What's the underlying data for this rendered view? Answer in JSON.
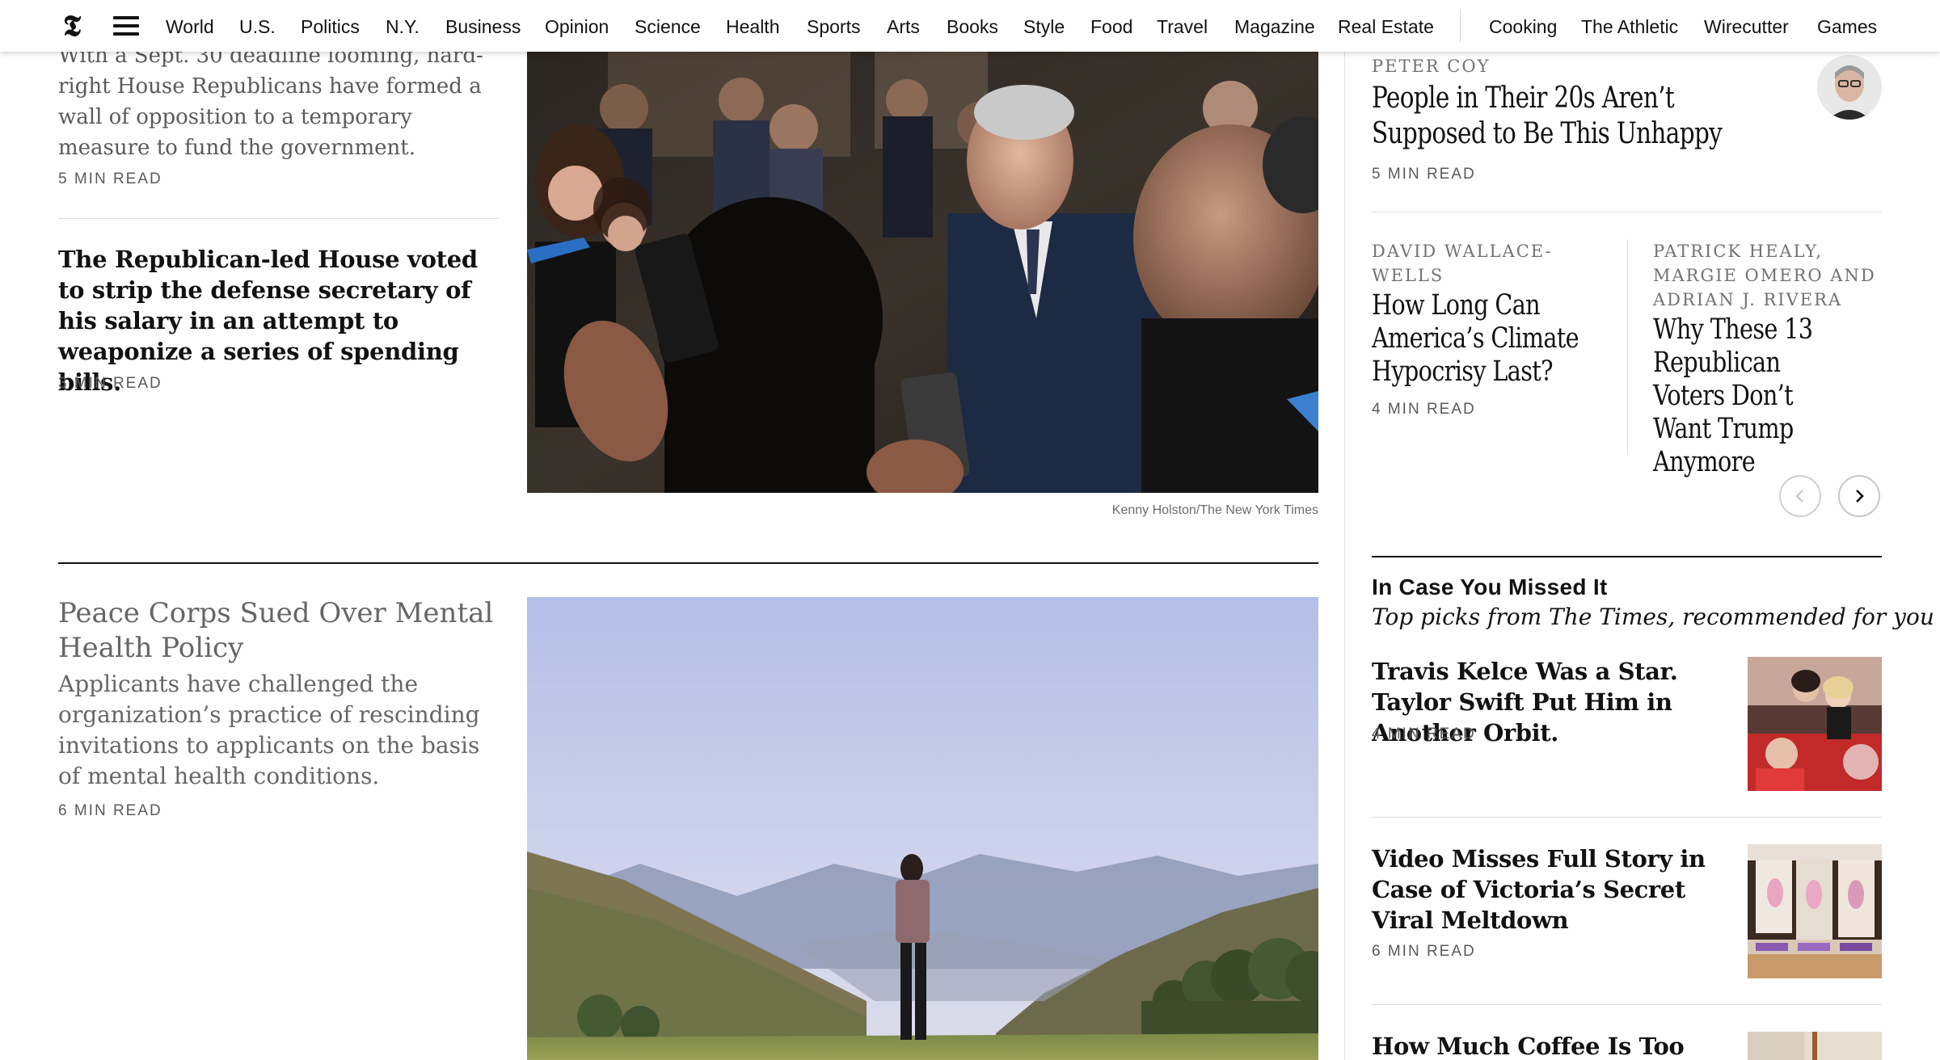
{
  "nav": {
    "logo": "𝕿",
    "items": [
      "World",
      "U.S.",
      "Politics",
      "N.Y.",
      "Business",
      "Opinion",
      "Science",
      "Health",
      "Sports",
      "Arts",
      "Books",
      "Style",
      "Food",
      "Travel",
      "Magazine",
      "Real Estate"
    ],
    "products": [
      "Cooking",
      "The Athletic",
      "Wirecutter",
      "Games"
    ]
  },
  "left": {
    "story1": {
      "summary": "With a Sept. 30 deadline looming, hard-right House Republicans have formed a wall of opposition to a temporary measure to fund the government.",
      "read_time": "5 MIN READ"
    },
    "story2": {
      "headline": "The Republican-led House voted to strip the defense secretary of his salary in an attempt to weaponize a series of spending bills.",
      "read_time": "3 MIN READ"
    },
    "story3": {
      "headline": "Peace Corps Sued Over Mental Health Policy",
      "summary": "Applicants have challenged the organization’s practice of rescinding invitations to applicants on the basis of mental health conditions.",
      "read_time": "6 MIN READ"
    },
    "photo_credit": "Kenny Holston/The New York Times"
  },
  "opinion": {
    "featured": {
      "byline": "PETER COY",
      "headline": "People in Their 20s Aren’t Supposed to Be This Unhappy",
      "read_time": "5 MIN READ"
    },
    "card1": {
      "byline": "DAVID WALLACE-WELLS",
      "headline": "How Long Can America’s Climate Hypocrisy Last?",
      "read_time": "4 MIN READ"
    },
    "card2": {
      "byline": "PATRICK HEALY, MARGIE OMERO AND ADRIAN J. RIVERA",
      "headline": "Why These 13 Republican Voters Don’t Want Trump Anymore"
    }
  },
  "icymi": {
    "title": "In Case You Missed It",
    "subtitle": "Top picks from The Times, recommended for you",
    "items": [
      {
        "headline": "Travis Kelce Was a Star. Taylor Swift Put Him in Another Orbit.",
        "read_time": "4 MIN READ"
      },
      {
        "headline": "Video Misses Full Story in Case of Victoria’s Secret Viral Meltdown",
        "read_time": "6 MIN READ"
      },
      {
        "headline": "How Much Coffee Is Too Much"
      }
    ]
  },
  "icons": {
    "menu": "hamburger-menu-icon",
    "prev": "chevron-left-icon",
    "next": "chevron-right-icon"
  }
}
